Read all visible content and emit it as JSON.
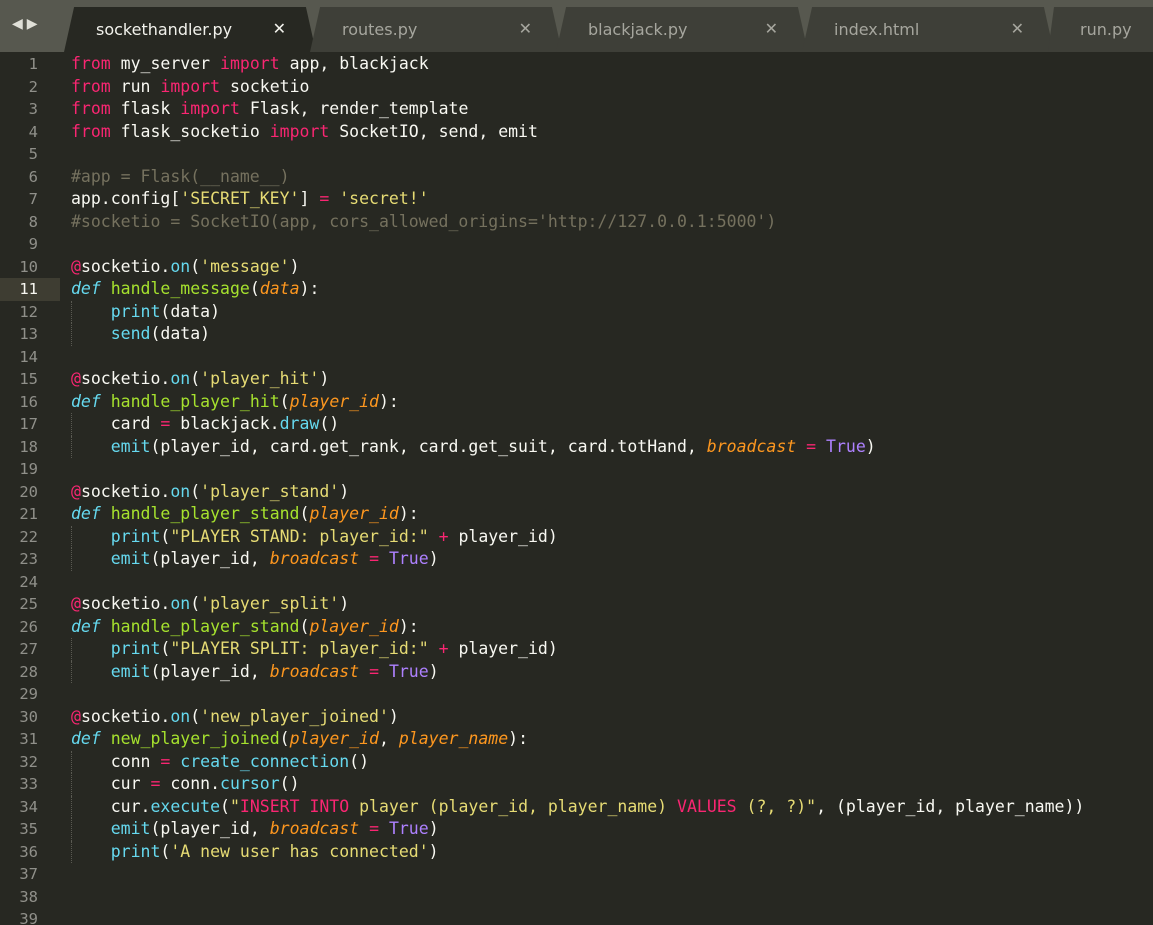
{
  "tabs": [
    {
      "label": "sockethandler.py",
      "active": true
    },
    {
      "label": "routes.py",
      "active": false
    },
    {
      "label": "blackjack.py",
      "active": false
    },
    {
      "label": "index.html",
      "active": false
    },
    {
      "label": "run.py",
      "active": false
    }
  ],
  "nav": {
    "back_glyph": "◀",
    "forward_glyph": "▶",
    "back_icon": "back-arrow-icon",
    "forward_icon": "forward-arrow-icon"
  },
  "close_glyph": "✕",
  "editor": {
    "current_line": 11,
    "lines": [
      {
        "n": "1",
        "segs": [
          [
            "k",
            "from"
          ],
          [
            "t",
            " my_server "
          ],
          [
            "k",
            "import"
          ],
          [
            "t",
            " app, blackjack"
          ]
        ]
      },
      {
        "n": "2",
        "segs": [
          [
            "k",
            "from"
          ],
          [
            "t",
            " run "
          ],
          [
            "k",
            "import"
          ],
          [
            "t",
            " socketio"
          ]
        ]
      },
      {
        "n": "3",
        "segs": [
          [
            "k",
            "from"
          ],
          [
            "t",
            " flask "
          ],
          [
            "k",
            "import"
          ],
          [
            "t",
            " Flask, render_template"
          ]
        ]
      },
      {
        "n": "4",
        "segs": [
          [
            "k",
            "from"
          ],
          [
            "t",
            " flask_socketio "
          ],
          [
            "k",
            "import"
          ],
          [
            "t",
            " SocketIO, send, emit"
          ]
        ]
      },
      {
        "n": "5",
        "segs": []
      },
      {
        "n": "6",
        "segs": [
          [
            "c",
            "#app = Flask(__name__)"
          ]
        ]
      },
      {
        "n": "7",
        "segs": [
          [
            "t",
            "app.config["
          ],
          [
            "s",
            "'SECRET_KEY'"
          ],
          [
            "t",
            "] "
          ],
          [
            "o",
            "="
          ],
          [
            "t",
            " "
          ],
          [
            "s",
            "'secret!'"
          ]
        ]
      },
      {
        "n": "8",
        "segs": [
          [
            "c",
            "#socketio = SocketIO(app, cors_allowed_origins='http://127.0.0.1:5000')"
          ]
        ]
      },
      {
        "n": "9",
        "segs": []
      },
      {
        "n": "10",
        "segs": [
          [
            "k",
            "@"
          ],
          [
            "t",
            "socketio."
          ],
          [
            "b",
            "on"
          ],
          [
            "t",
            "("
          ],
          [
            "s",
            "'message'"
          ],
          [
            "t",
            ")"
          ]
        ]
      },
      {
        "n": "11",
        "segs": [
          [
            "d",
            "def"
          ],
          [
            "t",
            " "
          ],
          [
            "f",
            "handle_message"
          ],
          [
            "t",
            "("
          ],
          [
            "p",
            "data"
          ],
          [
            "t",
            "):"
          ]
        ]
      },
      {
        "n": "12",
        "indent": 1,
        "segs": [
          [
            "t",
            "    "
          ],
          [
            "b",
            "print"
          ],
          [
            "t",
            "(data)"
          ]
        ]
      },
      {
        "n": "13",
        "indent": 1,
        "segs": [
          [
            "t",
            "    "
          ],
          [
            "b",
            "send"
          ],
          [
            "t",
            "(data)"
          ]
        ]
      },
      {
        "n": "14",
        "segs": []
      },
      {
        "n": "15",
        "segs": [
          [
            "k",
            "@"
          ],
          [
            "t",
            "socketio."
          ],
          [
            "b",
            "on"
          ],
          [
            "t",
            "("
          ],
          [
            "s",
            "'player_hit'"
          ],
          [
            "t",
            ")"
          ]
        ]
      },
      {
        "n": "16",
        "segs": [
          [
            "d",
            "def"
          ],
          [
            "t",
            " "
          ],
          [
            "f",
            "handle_player_hit"
          ],
          [
            "t",
            "("
          ],
          [
            "p",
            "player_id"
          ],
          [
            "t",
            "):"
          ]
        ]
      },
      {
        "n": "17",
        "indent": 1,
        "segs": [
          [
            "t",
            "    card "
          ],
          [
            "o",
            "="
          ],
          [
            "t",
            " blackjack."
          ],
          [
            "b",
            "draw"
          ],
          [
            "t",
            "()"
          ]
        ]
      },
      {
        "n": "18",
        "indent": 1,
        "segs": [
          [
            "t",
            "    "
          ],
          [
            "b",
            "emit"
          ],
          [
            "t",
            "(player_id, card.get_rank, card.get_suit, card.totHand, "
          ],
          [
            "p",
            "broadcast"
          ],
          [
            "t",
            " "
          ],
          [
            "o",
            "="
          ],
          [
            "t",
            " "
          ],
          [
            "n",
            "True"
          ],
          [
            "t",
            ")"
          ]
        ]
      },
      {
        "n": "19",
        "segs": []
      },
      {
        "n": "20",
        "segs": [
          [
            "k",
            "@"
          ],
          [
            "t",
            "socketio."
          ],
          [
            "b",
            "on"
          ],
          [
            "t",
            "("
          ],
          [
            "s",
            "'player_stand'"
          ],
          [
            "t",
            ")"
          ]
        ]
      },
      {
        "n": "21",
        "segs": [
          [
            "d",
            "def"
          ],
          [
            "t",
            " "
          ],
          [
            "f",
            "handle_player_stand"
          ],
          [
            "t",
            "("
          ],
          [
            "p",
            "player_id"
          ],
          [
            "t",
            "):"
          ]
        ]
      },
      {
        "n": "22",
        "indent": 1,
        "segs": [
          [
            "t",
            "    "
          ],
          [
            "b",
            "print"
          ],
          [
            "t",
            "("
          ],
          [
            "s",
            "\"PLAYER STAND: player_id:\""
          ],
          [
            "t",
            " "
          ],
          [
            "o",
            "+"
          ],
          [
            "t",
            " player_id)"
          ]
        ]
      },
      {
        "n": "23",
        "indent": 1,
        "segs": [
          [
            "t",
            "    "
          ],
          [
            "b",
            "emit"
          ],
          [
            "t",
            "(player_id, "
          ],
          [
            "p",
            "broadcast"
          ],
          [
            "t",
            " "
          ],
          [
            "o",
            "="
          ],
          [
            "t",
            " "
          ],
          [
            "n",
            "True"
          ],
          [
            "t",
            ")"
          ]
        ]
      },
      {
        "n": "24",
        "segs": []
      },
      {
        "n": "25",
        "segs": [
          [
            "k",
            "@"
          ],
          [
            "t",
            "socketio."
          ],
          [
            "b",
            "on"
          ],
          [
            "t",
            "("
          ],
          [
            "s",
            "'player_split'"
          ],
          [
            "t",
            ")"
          ]
        ]
      },
      {
        "n": "26",
        "segs": [
          [
            "d",
            "def"
          ],
          [
            "t",
            " "
          ],
          [
            "f",
            "handle_player_stand"
          ],
          [
            "t",
            "("
          ],
          [
            "p",
            "player_id"
          ],
          [
            "t",
            "):"
          ]
        ]
      },
      {
        "n": "27",
        "indent": 1,
        "segs": [
          [
            "t",
            "    "
          ],
          [
            "b",
            "print"
          ],
          [
            "t",
            "("
          ],
          [
            "s",
            "\"PLAYER SPLIT: player_id:\""
          ],
          [
            "t",
            " "
          ],
          [
            "o",
            "+"
          ],
          [
            "t",
            " player_id)"
          ]
        ]
      },
      {
        "n": "28",
        "indent": 1,
        "segs": [
          [
            "t",
            "    "
          ],
          [
            "b",
            "emit"
          ],
          [
            "t",
            "(player_id, "
          ],
          [
            "p",
            "broadcast"
          ],
          [
            "t",
            " "
          ],
          [
            "o",
            "="
          ],
          [
            "t",
            " "
          ],
          [
            "n",
            "True"
          ],
          [
            "t",
            ")"
          ]
        ]
      },
      {
        "n": "29",
        "segs": []
      },
      {
        "n": "30",
        "segs": [
          [
            "k",
            "@"
          ],
          [
            "t",
            "socketio."
          ],
          [
            "b",
            "on"
          ],
          [
            "t",
            "("
          ],
          [
            "s",
            "'new_player_joined'"
          ],
          [
            "t",
            ")"
          ]
        ]
      },
      {
        "n": "31",
        "segs": [
          [
            "d",
            "def"
          ],
          [
            "t",
            " "
          ],
          [
            "f",
            "new_player_joined"
          ],
          [
            "t",
            "("
          ],
          [
            "p",
            "player_id"
          ],
          [
            "t",
            ", "
          ],
          [
            "p",
            "player_name"
          ],
          [
            "t",
            "):"
          ]
        ]
      },
      {
        "n": "32",
        "indent": 1,
        "segs": [
          [
            "t",
            "    conn "
          ],
          [
            "o",
            "="
          ],
          [
            "t",
            " "
          ],
          [
            "b",
            "create_connection"
          ],
          [
            "t",
            "()"
          ]
        ]
      },
      {
        "n": "33",
        "indent": 1,
        "segs": [
          [
            "t",
            "    cur "
          ],
          [
            "o",
            "="
          ],
          [
            "t",
            " conn."
          ],
          [
            "b",
            "cursor"
          ],
          [
            "t",
            "()"
          ]
        ]
      },
      {
        "n": "34",
        "indent": 1,
        "segs": [
          [
            "t",
            "    cur."
          ],
          [
            "b",
            "execute"
          ],
          [
            "t",
            "("
          ],
          [
            "s",
            "\""
          ],
          [
            "k",
            "INSERT INTO"
          ],
          [
            "s",
            " player (player_id, player_name) "
          ],
          [
            "k",
            "VALUES"
          ],
          [
            "s",
            " (?, ?)\""
          ],
          [
            "t",
            ", (player_id, player_name))"
          ]
        ]
      },
      {
        "n": "35",
        "indent": 1,
        "segs": [
          [
            "t",
            "    "
          ],
          [
            "b",
            "emit"
          ],
          [
            "t",
            "(player_id, "
          ],
          [
            "p",
            "broadcast"
          ],
          [
            "t",
            " "
          ],
          [
            "o",
            "="
          ],
          [
            "t",
            " "
          ],
          [
            "n",
            "True"
          ],
          [
            "t",
            ")"
          ]
        ]
      },
      {
        "n": "36",
        "indent": 1,
        "segs": [
          [
            "t",
            "    "
          ],
          [
            "b",
            "print"
          ],
          [
            "t",
            "("
          ],
          [
            "s",
            "'A new user has connected'"
          ],
          [
            "t",
            ")"
          ]
        ]
      },
      {
        "n": "37",
        "segs": []
      },
      {
        "n": "38",
        "segs": []
      },
      {
        "n": "39",
        "segs": []
      }
    ]
  }
}
